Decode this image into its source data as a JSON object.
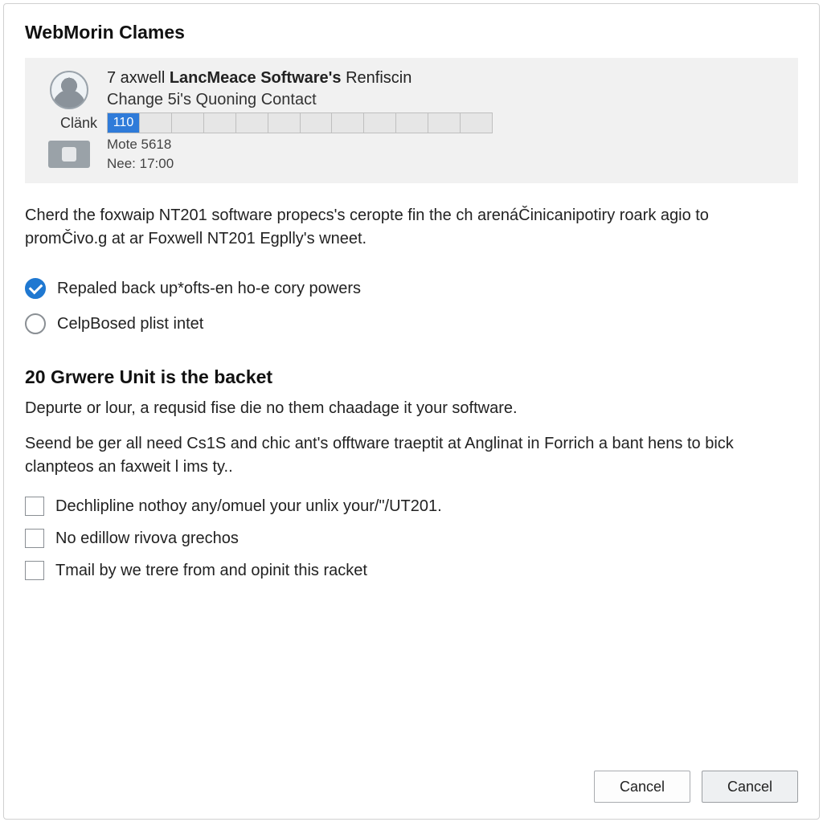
{
  "title": "WebMorin Clames",
  "info": {
    "line1_prefix": "7 axwell ",
    "line1_bold": "LancMeace Software's",
    "line1_suffix": " Renfiscin",
    "line2": "Change 5i's Quoning Contact",
    "clank_label": "Clänk",
    "progress_value": "110",
    "mote": "Mote 5618",
    "nee": "Nee: 17:00"
  },
  "body_text": "Cherd the foxwaip NT201 software propecs's ceropte fin the ch arenáČinicanipotiry roark agio to promČivo.g at ar Foxwell NT201 Egplly's wneet.",
  "radios": [
    {
      "label": "Repaled back up*ofts-en ho-e cory powers",
      "checked": true
    },
    {
      "label": "CelpBosed plist intet",
      "checked": false
    }
  ],
  "section": {
    "heading": "20 Grwere Unit is the backet",
    "sub": "Depurte or lour, a requsid fise die no them chaadage it your software.",
    "para": "Seend be ger all need Cs1S and chic ant's offtware traeptit at Anglinat in Forrich a bant hens to bick clanpteos an faxweit l ims ty.."
  },
  "checks": [
    {
      "label": "Dechlipline nothoy any/omuel your unlix your/\"/UT201."
    },
    {
      "label": "No edillow rivova grechos"
    },
    {
      "label": "Tmail by we trere from and opinit this racket"
    }
  ],
  "buttons": {
    "cancel1": "Cancel",
    "cancel2": "Cancel"
  }
}
